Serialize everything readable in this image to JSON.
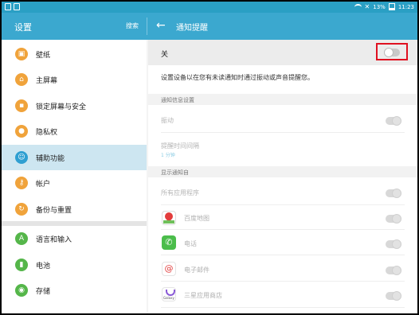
{
  "statusbar": {
    "battery": "13%",
    "time": "11:23"
  },
  "header": {
    "left_title": "设置",
    "search": "搜索",
    "page_title": "通知提醒"
  },
  "sidebar": {
    "items": [
      {
        "label": "壁纸",
        "icon": "wallpaper-icon"
      },
      {
        "label": "主屏幕",
        "icon": "home-icon"
      },
      {
        "label": "锁定屏幕与安全",
        "icon": "lock-icon"
      },
      {
        "label": "隐私权",
        "icon": "privacy-icon"
      },
      {
        "label": "辅助功能",
        "icon": "accessibility-icon",
        "active": true
      },
      {
        "label": "帐户",
        "icon": "key-icon"
      },
      {
        "label": "备份与重置",
        "icon": "backup-icon"
      },
      {
        "label": "语言和输入",
        "icon": "language-icon"
      },
      {
        "label": "电池",
        "icon": "battery-icon"
      },
      {
        "label": "存储",
        "icon": "storage-icon"
      }
    ]
  },
  "main": {
    "master_toggle_label": "关",
    "master_toggle_on": false,
    "description": "设置设备以在您有未读通知时通过振动或声音提醒您。",
    "section_notification_settings": "通知信息设置",
    "vibration_label": "振动",
    "interval_label": "提醒时间间隔",
    "interval_value": "1 分钟",
    "section_show_from": "显示通知自",
    "all_apps_label": "所有应用程序",
    "apps": [
      {
        "name": "百度地图",
        "icon": "baidu-map-icon"
      },
      {
        "name": "电话",
        "icon": "phone-icon"
      },
      {
        "name": "电子邮件",
        "icon": "email-icon"
      },
      {
        "name": "三星应用商店",
        "icon": "galaxy-apps-icon"
      }
    ]
  },
  "colors": {
    "header": "#3ba8cf",
    "statusbar": "#2a9fc4",
    "active_item_bg": "#cde6f1",
    "highlight_border": "#e01020",
    "item_icon": "#f0a33b"
  }
}
